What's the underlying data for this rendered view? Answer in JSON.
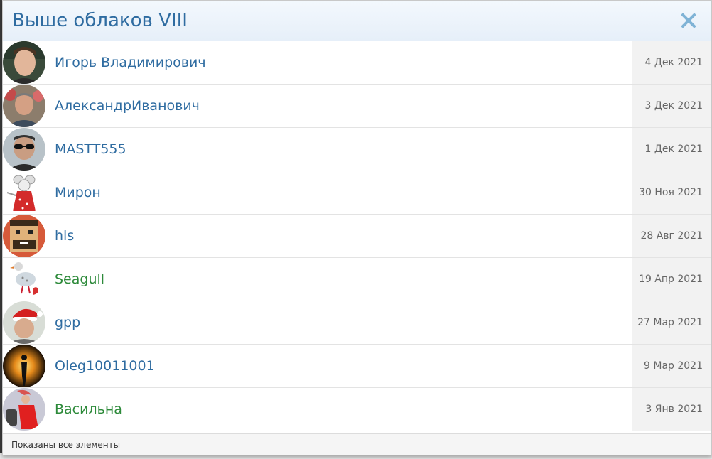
{
  "modal": {
    "title": "Выше облаков VIII",
    "close_icon": "close-icon",
    "footer": "Показаны все элементы"
  },
  "colors": {
    "title": "#2f6ca1",
    "link_blue": "#2f6ca1",
    "link_green": "#2d8a3a",
    "close": "#7fb3d6"
  },
  "users": [
    {
      "name": "Игорь Владимирович",
      "date": "4 Дек 2021",
      "color": "blue",
      "avatar": "avatar-photo-man"
    },
    {
      "name": "АлександрИванович",
      "date": "3 Дек 2021",
      "color": "blue",
      "avatar": "avatar-photo-man-flowers"
    },
    {
      "name": "MASTT555",
      "date": "1 Дек 2021",
      "color": "blue",
      "avatar": "avatar-photo-sunglasses"
    },
    {
      "name": "Мирон",
      "date": "30 Ноя 2021",
      "color": "blue",
      "avatar": "avatar-mouse-cartoon"
    },
    {
      "name": "hls",
      "date": "28 Авг 2021",
      "color": "blue",
      "avatar": "avatar-pixel-face"
    },
    {
      "name": "Seagull",
      "date": "19 Апр 2021",
      "color": "green",
      "avatar": "avatar-bird-cartoon"
    },
    {
      "name": "gpp",
      "date": "27 Мар 2021",
      "color": "blue",
      "avatar": "avatar-santa-hat"
    },
    {
      "name": "Oleg10011001",
      "date": "9 Мар 2021",
      "color": "blue",
      "avatar": "avatar-glowing-figure"
    },
    {
      "name": "Васильна",
      "date": "3 Янв 2021",
      "color": "green",
      "avatar": "avatar-photo-woman"
    }
  ]
}
